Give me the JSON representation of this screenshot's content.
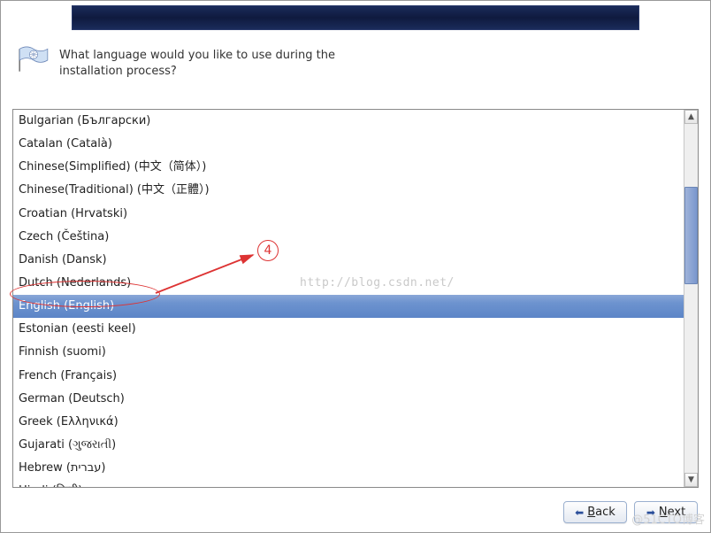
{
  "banner": {},
  "prompt": {
    "text_line1": "What language would you like to use during the",
    "text_line2": "installation process?"
  },
  "languages": {
    "items": [
      {
        "label": "Bulgarian (Български)",
        "selected": false
      },
      {
        "label": "Catalan (Català)",
        "selected": false
      },
      {
        "label": "Chinese(Simplified) (中文（简体）)",
        "selected": false
      },
      {
        "label": "Chinese(Traditional) (中文（正體）)",
        "selected": false
      },
      {
        "label": "Croatian (Hrvatski)",
        "selected": false
      },
      {
        "label": "Czech (Čeština)",
        "selected": false
      },
      {
        "label": "Danish (Dansk)",
        "selected": false
      },
      {
        "label": "Dutch (Nederlands)",
        "selected": false
      },
      {
        "label": "English (English)",
        "selected": true
      },
      {
        "label": "Estonian (eesti keel)",
        "selected": false
      },
      {
        "label": "Finnish (suomi)",
        "selected": false
      },
      {
        "label": "French (Français)",
        "selected": false
      },
      {
        "label": "German (Deutsch)",
        "selected": false
      },
      {
        "label": "Greek (Ελληνικά)",
        "selected": false
      },
      {
        "label": "Gujarati (ગુજરાતી)",
        "selected": false
      },
      {
        "label": "Hebrew (עברית)",
        "selected": false
      },
      {
        "label": "Hindi (हिन्दी)",
        "selected": false
      }
    ]
  },
  "buttons": {
    "back": {
      "prefix": "",
      "access": "B",
      "suffix": "ack"
    },
    "next": {
      "prefix": "",
      "access": "N",
      "suffix": "ext"
    }
  },
  "annotation": {
    "badge_number": "4"
  },
  "watermark": {
    "url": "http://blog.csdn.net/",
    "corner": "@51CTO博客"
  }
}
